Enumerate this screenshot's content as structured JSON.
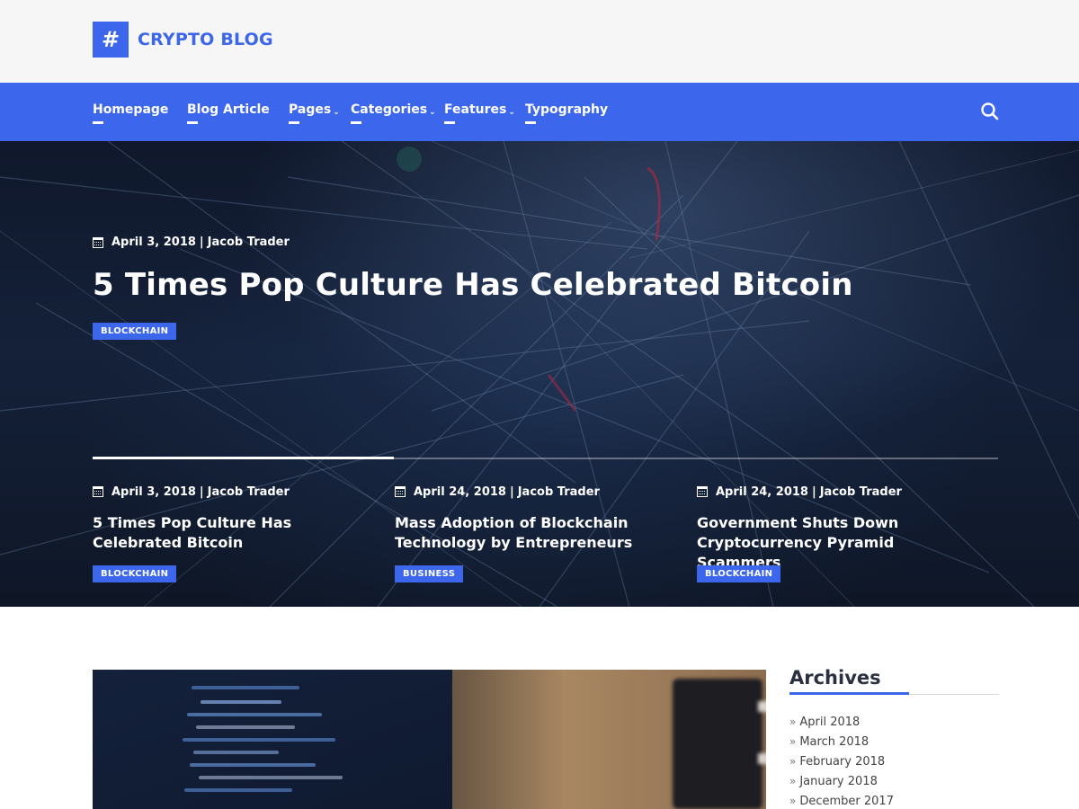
{
  "brand": {
    "logo_mark": "#",
    "name": "CRYPTO BLOG",
    "accent_color": "#3c66ec"
  },
  "nav": {
    "items": [
      {
        "label": "Homepage",
        "dropdown": false
      },
      {
        "label": "Blog Article",
        "dropdown": false
      },
      {
        "label": "Pages",
        "dropdown": true
      },
      {
        "label": "Categories",
        "dropdown": true
      },
      {
        "label": "Features",
        "dropdown": true
      },
      {
        "label": "Typography",
        "dropdown": false
      }
    ],
    "search_icon": "search-icon",
    "caret": "⌄"
  },
  "hero": {
    "date": "April 3, 2018",
    "separator": "|",
    "author": "Jacob Trader",
    "title": "5 Times Pop Culture Has Celebrated Bitcoin",
    "category": "BLOCKCHAIN",
    "slider_progress": 0.333
  },
  "slides": [
    {
      "date": "April 3, 2018",
      "separator": "|",
      "author": "Jacob Trader",
      "title": "5 Times Pop Culture Has Celebrated Bitcoin",
      "category": "BLOCKCHAIN"
    },
    {
      "date": "April 24, 2018",
      "separator": "|",
      "author": "Jacob Trader",
      "title": "Mass Adoption of Blockchain Technology by Entrepreneurs",
      "category": "BUSINESS"
    },
    {
      "date": "April 24, 2018",
      "separator": "|",
      "author": "Jacob Trader",
      "title": "Government Shuts Down Cryptocurrency Pyramid Scammers",
      "category": "BLOCKCHAIN"
    }
  ],
  "sidebar": {
    "archives_title": "Archives",
    "archives": [
      "April 2018",
      "March 2018",
      "February 2018",
      "January 2018",
      "December 2017"
    ]
  }
}
